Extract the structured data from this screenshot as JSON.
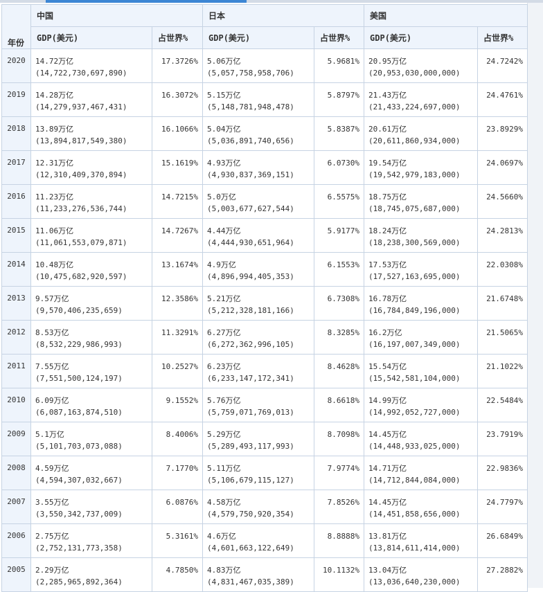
{
  "table": {
    "year_label": "年份",
    "countries": [
      "中国",
      "日本",
      "美国"
    ],
    "gdp_label": "GDP(美元)",
    "share_label": "占世界%",
    "rows": [
      {
        "year": "2020",
        "cn_gdp": "14.72万亿",
        "cn_full": "(14,722,730,697,890)",
        "cn_pct": "17.3726%",
        "jp_gdp": "5.06万亿",
        "jp_full": "(5,057,758,958,706)",
        "jp_pct": "5.9681%",
        "us_gdp": "20.95万亿",
        "us_full": "(20,953,030,000,000)",
        "us_pct": "24.7242%"
      },
      {
        "year": "2019",
        "cn_gdp": "14.28万亿",
        "cn_full": "(14,279,937,467,431)",
        "cn_pct": "16.3072%",
        "jp_gdp": "5.15万亿",
        "jp_full": "(5,148,781,948,478)",
        "jp_pct": "5.8797%",
        "us_gdp": "21.43万亿",
        "us_full": "(21,433,224,697,000)",
        "us_pct": "24.4761%"
      },
      {
        "year": "2018",
        "cn_gdp": "13.89万亿",
        "cn_full": "(13,894,817,549,380)",
        "cn_pct": "16.1066%",
        "jp_gdp": "5.04万亿",
        "jp_full": "(5,036,891,740,656)",
        "jp_pct": "5.8387%",
        "us_gdp": "20.61万亿",
        "us_full": "(20,611,860,934,000)",
        "us_pct": "23.8929%"
      },
      {
        "year": "2017",
        "cn_gdp": "12.31万亿",
        "cn_full": "(12,310,409,370,894)",
        "cn_pct": "15.1619%",
        "jp_gdp": "4.93万亿",
        "jp_full": "(4,930,837,369,151)",
        "jp_pct": "6.0730%",
        "us_gdp": "19.54万亿",
        "us_full": "(19,542,979,183,000)",
        "us_pct": "24.0697%"
      },
      {
        "year": "2016",
        "cn_gdp": "11.23万亿",
        "cn_full": "(11,233,276,536,744)",
        "cn_pct": "14.7215%",
        "jp_gdp": "5.0万亿",
        "jp_full": "(5,003,677,627,544)",
        "jp_pct": "6.5575%",
        "us_gdp": "18.75万亿",
        "us_full": "(18,745,075,687,000)",
        "us_pct": "24.5660%"
      },
      {
        "year": "2015",
        "cn_gdp": "11.06万亿",
        "cn_full": "(11,061,553,079,871)",
        "cn_pct": "14.7267%",
        "jp_gdp": "4.44万亿",
        "jp_full": "(4,444,930,651,964)",
        "jp_pct": "5.9177%",
        "us_gdp": "18.24万亿",
        "us_full": "(18,238,300,569,000)",
        "us_pct": "24.2813%"
      },
      {
        "year": "2014",
        "cn_gdp": "10.48万亿",
        "cn_full": "(10,475,682,920,597)",
        "cn_pct": "13.1674%",
        "jp_gdp": "4.9万亿",
        "jp_full": "(4,896,994,405,353)",
        "jp_pct": "6.1553%",
        "us_gdp": "17.53万亿",
        "us_full": "(17,527,163,695,000)",
        "us_pct": "22.0308%"
      },
      {
        "year": "2013",
        "cn_gdp": "9.57万亿",
        "cn_full": "(9,570,406,235,659)",
        "cn_pct": "12.3586%",
        "jp_gdp": "5.21万亿",
        "jp_full": "(5,212,328,181,166)",
        "jp_pct": "6.7308%",
        "us_gdp": "16.78万亿",
        "us_full": "(16,784,849,196,000)",
        "us_pct": "21.6748%"
      },
      {
        "year": "2012",
        "cn_gdp": "8.53万亿",
        "cn_full": "(8,532,229,986,993)",
        "cn_pct": "11.3291%",
        "jp_gdp": "6.27万亿",
        "jp_full": "(6,272,362,996,105)",
        "jp_pct": "8.3285%",
        "us_gdp": "16.2万亿",
        "us_full": "(16,197,007,349,000)",
        "us_pct": "21.5065%"
      },
      {
        "year": "2011",
        "cn_gdp": "7.55万亿",
        "cn_full": "(7,551,500,124,197)",
        "cn_pct": "10.2527%",
        "jp_gdp": "6.23万亿",
        "jp_full": "(6,233,147,172,341)",
        "jp_pct": "8.4628%",
        "us_gdp": "15.54万亿",
        "us_full": "(15,542,581,104,000)",
        "us_pct": "21.1022%"
      },
      {
        "year": "2010",
        "cn_gdp": "6.09万亿",
        "cn_full": "(6,087,163,874,510)",
        "cn_pct": "9.1552%",
        "jp_gdp": "5.76万亿",
        "jp_full": "(5,759,071,769,013)",
        "jp_pct": "8.6618%",
        "us_gdp": "14.99万亿",
        "us_full": "(14,992,052,727,000)",
        "us_pct": "22.5484%"
      },
      {
        "year": "2009",
        "cn_gdp": "5.1万亿",
        "cn_full": "(5,101,703,073,088)",
        "cn_pct": "8.4006%",
        "jp_gdp": "5.29万亿",
        "jp_full": "(5,289,493,117,993)",
        "jp_pct": "8.7098%",
        "us_gdp": "14.45万亿",
        "us_full": "(14,448,933,025,000)",
        "us_pct": "23.7919%"
      },
      {
        "year": "2008",
        "cn_gdp": "4.59万亿",
        "cn_full": "(4,594,307,032,667)",
        "cn_pct": "7.1770%",
        "jp_gdp": "5.11万亿",
        "jp_full": "(5,106,679,115,127)",
        "jp_pct": "7.9774%",
        "us_gdp": "14.71万亿",
        "us_full": "(14,712,844,084,000)",
        "us_pct": "22.9836%"
      },
      {
        "year": "2007",
        "cn_gdp": "3.55万亿",
        "cn_full": "(3,550,342,737,009)",
        "cn_pct": "6.0876%",
        "jp_gdp": "4.58万亿",
        "jp_full": "(4,579,750,920,354)",
        "jp_pct": "7.8526%",
        "us_gdp": "14.45万亿",
        "us_full": "(14,451,858,656,000)",
        "us_pct": "24.7797%"
      },
      {
        "year": "2006",
        "cn_gdp": "2.75万亿",
        "cn_full": "(2,752,131,773,358)",
        "cn_pct": "5.3161%",
        "jp_gdp": "4.6万亿",
        "jp_full": "(4,601,663,122,649)",
        "jp_pct": "8.8888%",
        "us_gdp": "13.81万亿",
        "us_full": "(13,814,611,414,000)",
        "us_pct": "26.6849%"
      },
      {
        "year": "2005",
        "cn_gdp": "2.29万亿",
        "cn_full": "(2,285,965,892,364)",
        "cn_pct": "4.7850%",
        "jp_gdp": "4.83万亿",
        "jp_full": "(4,831,467,035,389)",
        "jp_pct": "10.1132%",
        "us_gdp": "13.04万亿",
        "us_full": "(13,036,640,230,000)",
        "us_pct": "27.2882%"
      }
    ]
  }
}
